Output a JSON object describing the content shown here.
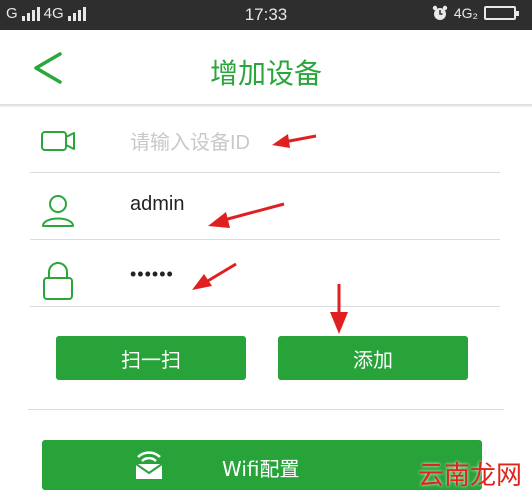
{
  "status_bar": {
    "left_signal_1": "G",
    "left_signal_2": "4G",
    "time": "17:33",
    "right_network": "4G₂"
  },
  "header": {
    "title": "增加设备"
  },
  "form": {
    "device_id_placeholder": "请输入设备ID",
    "username_value": "admin",
    "password_value": "••••••"
  },
  "buttons": {
    "scan_label": "扫一扫",
    "add_label": "添加",
    "wifi_label": "Wifi配置"
  },
  "watermark": "云南龙网",
  "colors": {
    "accent": "#27a33a",
    "arrow": "#e02020",
    "status_bg": "#2e2e2e"
  }
}
